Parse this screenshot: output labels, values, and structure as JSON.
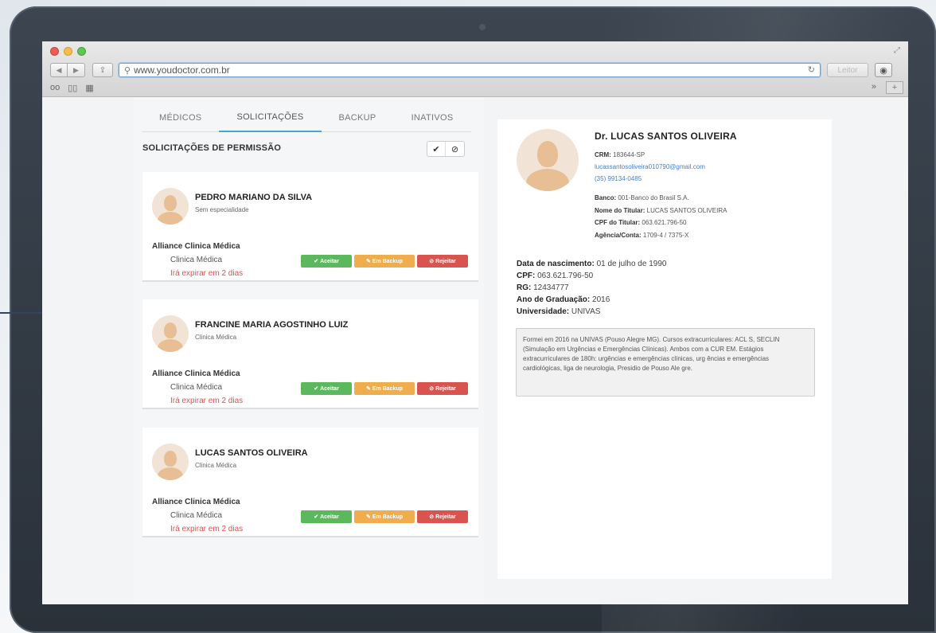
{
  "browser": {
    "url": "www.youdoctor.com.br",
    "reader_label": "Leitor"
  },
  "tabs": [
    {
      "label": "Médicos",
      "active": false
    },
    {
      "label": "Solicitações",
      "active": true
    },
    {
      "label": "Backup",
      "active": false
    },
    {
      "label": "Inativos",
      "active": false
    }
  ],
  "requests": {
    "title": "SOLICITAÇÕES DE PERMISSÃO",
    "filter_accept_icon": "✔",
    "filter_reject_icon": "⊘",
    "buttons": {
      "accept": "Aceitar",
      "backup": "Em Backup",
      "reject": "Rejeitar"
    },
    "cards": [
      {
        "name": "PEDRO MARIANO DA SILVA",
        "specialty": "Sem especialidade",
        "clinic": "Alliance Clinica Médica",
        "type": "Clinica Médica",
        "expires": "Irá expirar em 2 dias"
      },
      {
        "name": "FRANCINE MARIA AGOSTINHO LUIZ",
        "specialty": "Clinica Médica",
        "clinic": "Alliance Clinica Médica",
        "type": "Clinica Médica",
        "expires": "Irá expirar em 2 dias"
      },
      {
        "name": "LUCAS SANTOS OLIVEIRA",
        "specialty": "Clinica Médica",
        "clinic": "Alliance Clinica Médica",
        "type": "Clinica Médica",
        "expires": "Irá expirar em 2 dias"
      }
    ]
  },
  "detail": {
    "name": "Dr. LUCAS SANTOS OLIVEIRA",
    "crm_label": "CRM:",
    "crm": "183644-SP",
    "email": "lucassantosoliveira010790@gmail.com",
    "phone": "(35) 99134-0485",
    "bank_label": "Banco:",
    "bank": "001-Banco do Brasil S.A.",
    "holder_label": "Nome do Titular:",
    "holder": "LUCAS SANTOS OLIVEIRA",
    "holder_cpf_label": "CPF do Titular:",
    "holder_cpf": "063.621.796-50",
    "account_label": "Agência/Conta:",
    "account": "1709-4 / 7375-X",
    "birth_label": "Data de nascimento:",
    "birth": "01 de julho de 1990",
    "cpf_label": "CPF:",
    "cpf": "063.621.796-50",
    "rg_label": "RG:",
    "rg": "12434777",
    "grad_label": "Ano de Graduação:",
    "grad": "2016",
    "uni_label": "Universidade:",
    "uni": "UNIVAS",
    "bio": "Formei em 2016 na UNIVAS (Pouso Alegre MG). Cursos extracurriculares: ACL S, SECLIN (Simulação em Urgências e Emergências Clínicas). Ambos com a CUR EM. Estágios extracurriculares de 180h: urgências e emergências clínicas, urg ências e emergências cardiológicas, liga de neurologia, Presidio de Pouso Ale gre."
  },
  "colors": {
    "accept": "#5cb85c",
    "backup": "#f0ad4e",
    "reject": "#d9534f",
    "active_tab": "#47a8cf",
    "expire_text": "#d9534f",
    "callout": "#2f4560"
  }
}
